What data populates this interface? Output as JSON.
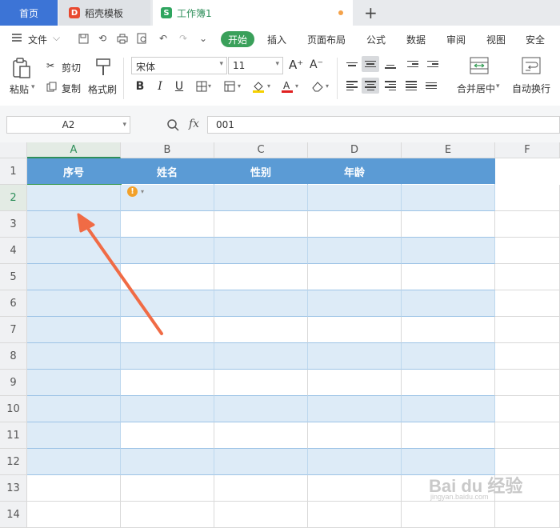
{
  "tabs": {
    "home": "首页",
    "docer": "稻壳模板",
    "workbook": "工作簿1",
    "docer_logo": "D",
    "workbook_logo": "S"
  },
  "menu": {
    "file": "文件",
    "start": "开始",
    "insert": "插入",
    "page_layout": "页面布局",
    "formula": "公式",
    "data": "数据",
    "review": "审阅",
    "view": "视图",
    "security": "安全"
  },
  "ribbon": {
    "paste": "粘贴",
    "cut": "剪切",
    "copy": "复制",
    "format_painter": "格式刷",
    "font_name": "宋体",
    "font_size": "11",
    "merge_center": "合并居中",
    "wrap_text": "自动换行"
  },
  "formula_bar": {
    "name_box": "A2",
    "fx": "fx",
    "content": "001"
  },
  "sheet": {
    "columns": [
      "A",
      "B",
      "C",
      "D",
      "E",
      "F"
    ],
    "rows": [
      "1",
      "2",
      "3",
      "4",
      "5",
      "6",
      "7",
      "8",
      "9",
      "10",
      "11",
      "12",
      "13",
      "14"
    ],
    "headers": [
      "序号",
      "姓名",
      "性别",
      "年龄"
    ],
    "a2_value": "001"
  },
  "watermark": {
    "brand": "Bai du",
    "brand_cn": "经验",
    "url": "jingyan.baidu.com"
  },
  "colors": {
    "header_fill": "#5b9bd5",
    "band_fill": "#ddebf7",
    "accent_green": "#3aa05a",
    "arrow": "#f06b45"
  }
}
